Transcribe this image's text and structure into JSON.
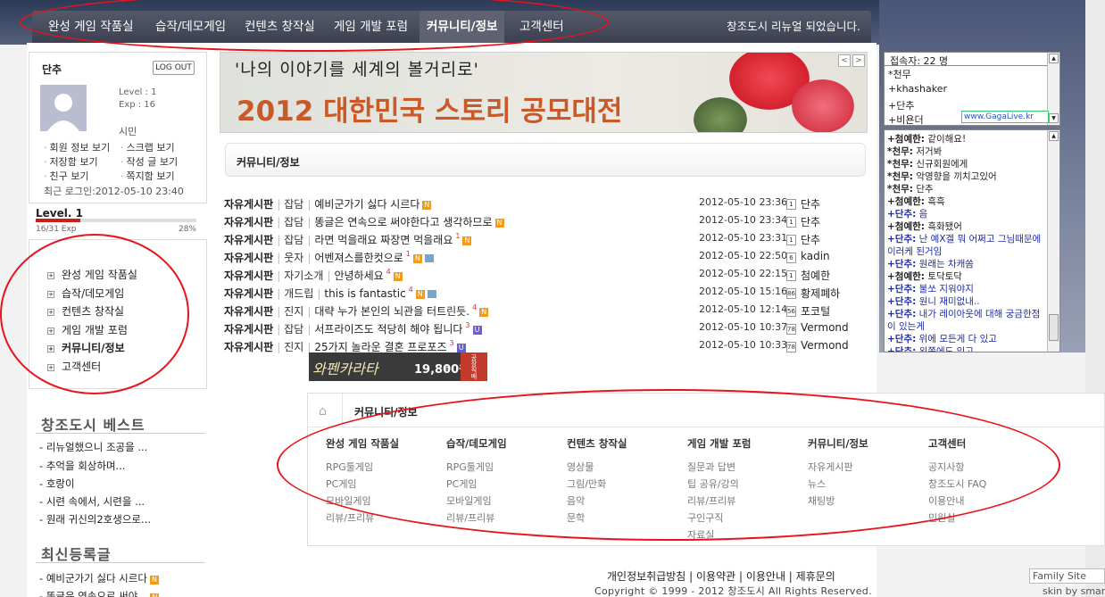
{
  "nav": {
    "items": [
      "완성 게임 작품실",
      "습작/데모게임",
      "컨텐츠 창작실",
      "게임 개발 포럼",
      "커뮤니티/정보",
      "고객센터"
    ],
    "active": "커뮤니티/정보",
    "notice": "창조도시 리뉴얼 되었습니다."
  },
  "login": {
    "user": "단추",
    "logout": "LOG OUT",
    "level": "Level : 1",
    "exp": "Exp : 16",
    "rank": "시민",
    "links": [
      "회원 정보 보기",
      "스크랩 보기",
      "저장함 보기",
      "작성 글 보기",
      "친구 보기",
      "쪽지함 보기"
    ],
    "last_login": "최근 로그인:2012-05-10 23:40"
  },
  "level_box": {
    "title": "Level. 1",
    "exp": "16/31 Exp",
    "percent_label": "28%",
    "progress": 0.28
  },
  "category_menu": [
    "완성 게임 작품실",
    "습작/데모게임",
    "컨텐츠 창작실",
    "게임 개발 포럼",
    "커뮤니티/정보",
    "고객센터"
  ],
  "best": {
    "title": "창조도시 베스트",
    "items": [
      "리뉴얼했으니 조공을 ...",
      "추억을 회상하며...",
      "호랑이",
      "시련 속에서, 시련을 ...",
      "원래 귀신의2호생으로..."
    ]
  },
  "recent": {
    "title": "최신등록글",
    "items": [
      "예비군가기 싫다 시르다",
      "똥글은 연속으로 써야..."
    ]
  },
  "banner": {
    "quote": "'나의 이야기를 세계의 볼거리로'",
    "title": "2012 대한민국 스토리 공모대전",
    "prev": "<",
    "next": ">"
  },
  "board": {
    "tab_title": "커뮤니티/정보",
    "rows": [
      {
        "board": "자유게시판",
        "cat": "잡담",
        "title": "예비군가기 싫다 시르다",
        "count": "",
        "new": true,
        "file": false,
        "u": false,
        "date": "2012-05-10",
        "time": "23:36",
        "lv": "1",
        "author": "단추"
      },
      {
        "board": "자유게시판",
        "cat": "잡담",
        "title": "똥글은 연속으로 써야한다고 생각하므로",
        "count": "",
        "new": true,
        "file": false,
        "u": false,
        "date": "2012-05-10",
        "time": "23:34",
        "lv": "1",
        "author": "단추"
      },
      {
        "board": "자유게시판",
        "cat": "잡담",
        "title": "라면 먹을래요 짜장면 먹을래요",
        "count": "1",
        "new": true,
        "file": false,
        "u": false,
        "date": "2012-05-10",
        "time": "23:31",
        "lv": "1",
        "author": "단추"
      },
      {
        "board": "자유게시판",
        "cat": "웃자",
        "title": "어벤져스를한컷으로",
        "count": "1",
        "new": true,
        "file": true,
        "u": false,
        "date": "2012-05-10",
        "time": "22:50",
        "lv": "6",
        "author": "kadin"
      },
      {
        "board": "자유게시판",
        "cat": "자기소개",
        "title": "안녕하세요",
        "count": "4",
        "new": true,
        "file": false,
        "u": false,
        "date": "2012-05-10",
        "time": "22:15",
        "lv": "1",
        "author": "첨예한"
      },
      {
        "board": "자유게시판",
        "cat": "개드립",
        "title": "this is fantastic",
        "count": "4",
        "new": true,
        "file": true,
        "u": false,
        "date": "2012-05-10",
        "time": "15:16",
        "lv": "86",
        "author": "황제폐하"
      },
      {
        "board": "자유게시판",
        "cat": "진지",
        "title": "대략 누가 본인의 뇌관을 터트린듯.",
        "count": "4",
        "new": true,
        "file": false,
        "u": false,
        "date": "2012-05-10",
        "time": "12:14",
        "lv": "56",
        "author": "포코털"
      },
      {
        "board": "자유게시판",
        "cat": "잡담",
        "title": "서프라이즈도 적당히 해야 됩니다",
        "count": "3",
        "new": false,
        "file": false,
        "u": true,
        "date": "2012-05-10",
        "time": "10:37",
        "lv": "78",
        "author": "Vermond"
      },
      {
        "board": "자유게시판",
        "cat": "진지",
        "title": "25가지 놀라운 결혼 프로포즈",
        "count": "3",
        "new": false,
        "file": false,
        "u": true,
        "date": "2012-05-10",
        "time": "10:33",
        "lv": "78",
        "author": "Vermond"
      }
    ]
  },
  "ad": {
    "text": "와펜카라타",
    "price": "19,800원",
    "badge": "공장직배송"
  },
  "sitemap": {
    "title": "커뮤니티/정보",
    "columns": [
      {
        "title": "완성 게임 작품실",
        "items": [
          "RPG툴게임",
          "PC게임",
          "모바일게임",
          "리뷰/프리뷰"
        ]
      },
      {
        "title": "습작/데모게임",
        "items": [
          "RPG툴게임",
          "PC게임",
          "모바일게임",
          "리뷰/프리뷰"
        ]
      },
      {
        "title": "컨텐츠 창작실",
        "items": [
          "영상물",
          "그림/만화",
          "음악",
          "문학"
        ]
      },
      {
        "title": "게임 개발 포럼",
        "items": [
          "질문과 답변",
          "팁 공유/강의",
          "리뷰/프리뷰",
          "구인구직",
          "자료실"
        ]
      },
      {
        "title": "커뮤니티/정보",
        "items": [
          "자유게시판",
          "뉴스",
          "채팅방"
        ]
      },
      {
        "title": "고객센터",
        "items": [
          "공지사항",
          "창조도시 FAQ",
          "이용안내",
          "민원실"
        ]
      }
    ]
  },
  "footer": {
    "links": "개인정보취급방침 | 이용약관 | 이용안내 | 제휴문의",
    "copyright": "Copyright © 1999 - 2012 창조도시 All Rights Reserved.",
    "family": "Family Site",
    "skin": "skin by smart"
  },
  "chat": {
    "users_count": "접속자: 22 명",
    "users": [
      "*천무",
      "+khashaker",
      "+단추",
      "+비욘더"
    ],
    "gaga": "www.GagaLive.kr",
    "messages": [
      {
        "name": "+첨예한:",
        "text": "같이해요!",
        "color": "black"
      },
      {
        "name": "*천무:",
        "text": "저거봐",
        "color": "black"
      },
      {
        "name": "*천무:",
        "text": "신규회원에게",
        "color": "black"
      },
      {
        "name": "*천무:",
        "text": "악영향을 끼치고있어",
        "color": "black"
      },
      {
        "name": "*천무:",
        "text": "단추",
        "color": "black"
      },
      {
        "name": "+첨예한:",
        "text": "흑흑",
        "color": "black"
      },
      {
        "name": "+단추:",
        "text": "음",
        "color": "blue"
      },
      {
        "name": "+첨예한:",
        "text": "흑화됐어",
        "color": "black"
      },
      {
        "name": "+단추:",
        "text": "난 예X겔 뭐 어쩌고 그님때문에 이러케 된거임",
        "color": "blue"
      },
      {
        "name": "+단추:",
        "text": "원래는 차캐쏨",
        "color": "blue"
      },
      {
        "name": "+첨예한:",
        "text": "토닥토닥",
        "color": "black"
      },
      {
        "name": "+단추:",
        "text": "불쏘 지워야지",
        "color": "blue"
      },
      {
        "name": "+단추:",
        "text": "원니 재미없내..",
        "color": "blue"
      },
      {
        "name": "+단추:",
        "text": "내가 레이아웃에 대해 궁금한점이 있는게",
        "color": "blue"
      },
      {
        "name": "+단추:",
        "text": "위에 모든게 다 있고",
        "color": "blue"
      },
      {
        "name": "+단추:",
        "text": "왼쪽에도 있고",
        "color": "blue"
      }
    ]
  }
}
